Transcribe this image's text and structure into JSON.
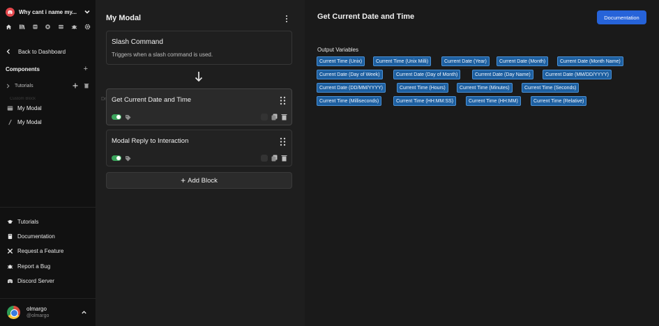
{
  "server": {
    "name": "Why cant i name my..."
  },
  "sidebar": {
    "back_label": "Back to Dashboard",
    "components_heading": "Components",
    "tutorials_label": "Tutorials",
    "ghost_row": "Custom Block",
    "drag_ghost": "Dr",
    "items": [
      {
        "label": "My Modal"
      },
      {
        "label": "My Modal"
      }
    ],
    "footer": [
      {
        "label": "Tutorials"
      },
      {
        "label": "Documentation"
      },
      {
        "label": "Request a Feature"
      },
      {
        "label": "Report a Bug"
      },
      {
        "label": "Discord Server"
      }
    ]
  },
  "user": {
    "name": "olmargo",
    "handle": "@olmargo"
  },
  "editor": {
    "title": "My Modal",
    "trigger": {
      "title": "Slash Command",
      "description": "Triggers when a slash command is used."
    },
    "blocks": [
      {
        "title": "Get Current Date and Time"
      },
      {
        "title": "Modal Reply to Interaction"
      }
    ],
    "add_block_label": "Add Block"
  },
  "panel": {
    "title": "Get Current Date and Time",
    "documentation_label": "Documentation",
    "output_label": "Output Variables",
    "variables": [
      "Current Time (Unix)",
      "Current Time (Unix Milli)",
      "Current Date (Year)",
      "Current Date (Month)",
      "Current Date (Month Name)",
      "Current Date (Day of Week)",
      "Current Date (Day of Month)",
      "Current Date (Day Name)",
      "Current Date (MM/DD/YYYY)",
      "Current Date (DD/MM/YYYY)",
      "Current Time (Hours)",
      "Current Time (Minutes)",
      "Current Time (Seconds)",
      "Current Time (Milliseconds)",
      "Current Time (HH:MM:SS)",
      "Current Time (HH:MM)",
      "Current Time (Relative)"
    ]
  },
  "colors": {
    "accent": "#2663d9",
    "chip": "#1d5fa0",
    "toggle": "#3ba55c",
    "server": "#e5484d"
  },
  "icons": [
    "discord-icon",
    "chevron-down-icon",
    "home-icon",
    "library-icon",
    "database-icon",
    "globe-icon",
    "server-icon",
    "bug-icon",
    "gear-icon",
    "chevron-left-icon",
    "plus-icon",
    "trash-icon",
    "modal-icon",
    "slash-icon",
    "graduation-cap-icon",
    "book-icon",
    "tools-icon",
    "bug-report-icon",
    "kebab-icon",
    "arrow-down-icon",
    "grip-icon",
    "tag-icon",
    "copy-icon",
    "checkbox-icon"
  ]
}
